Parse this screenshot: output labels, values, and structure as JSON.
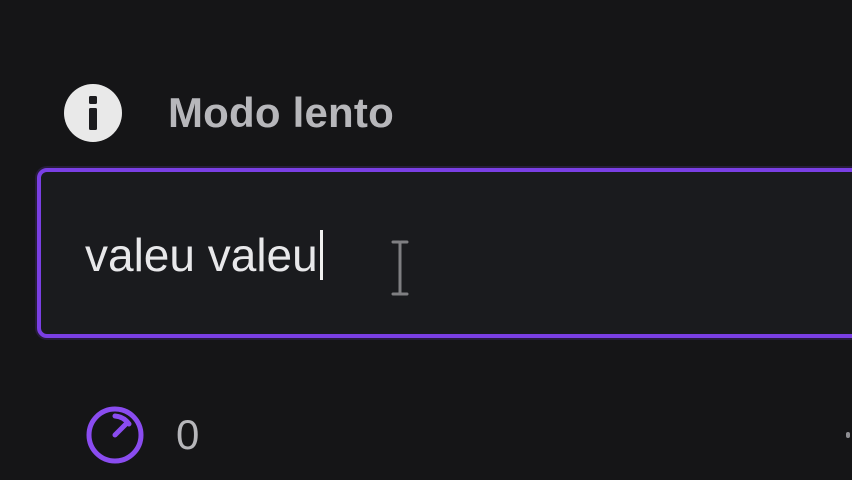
{
  "slow_mode": {
    "label": "Modo lento",
    "icon": "info-icon"
  },
  "chat_input": {
    "value": "valeu valeu",
    "border_color": "#7a3fe4"
  },
  "bits": {
    "count": "0",
    "icon": "timer-icon",
    "accent_color": "#8a4cf0"
  }
}
